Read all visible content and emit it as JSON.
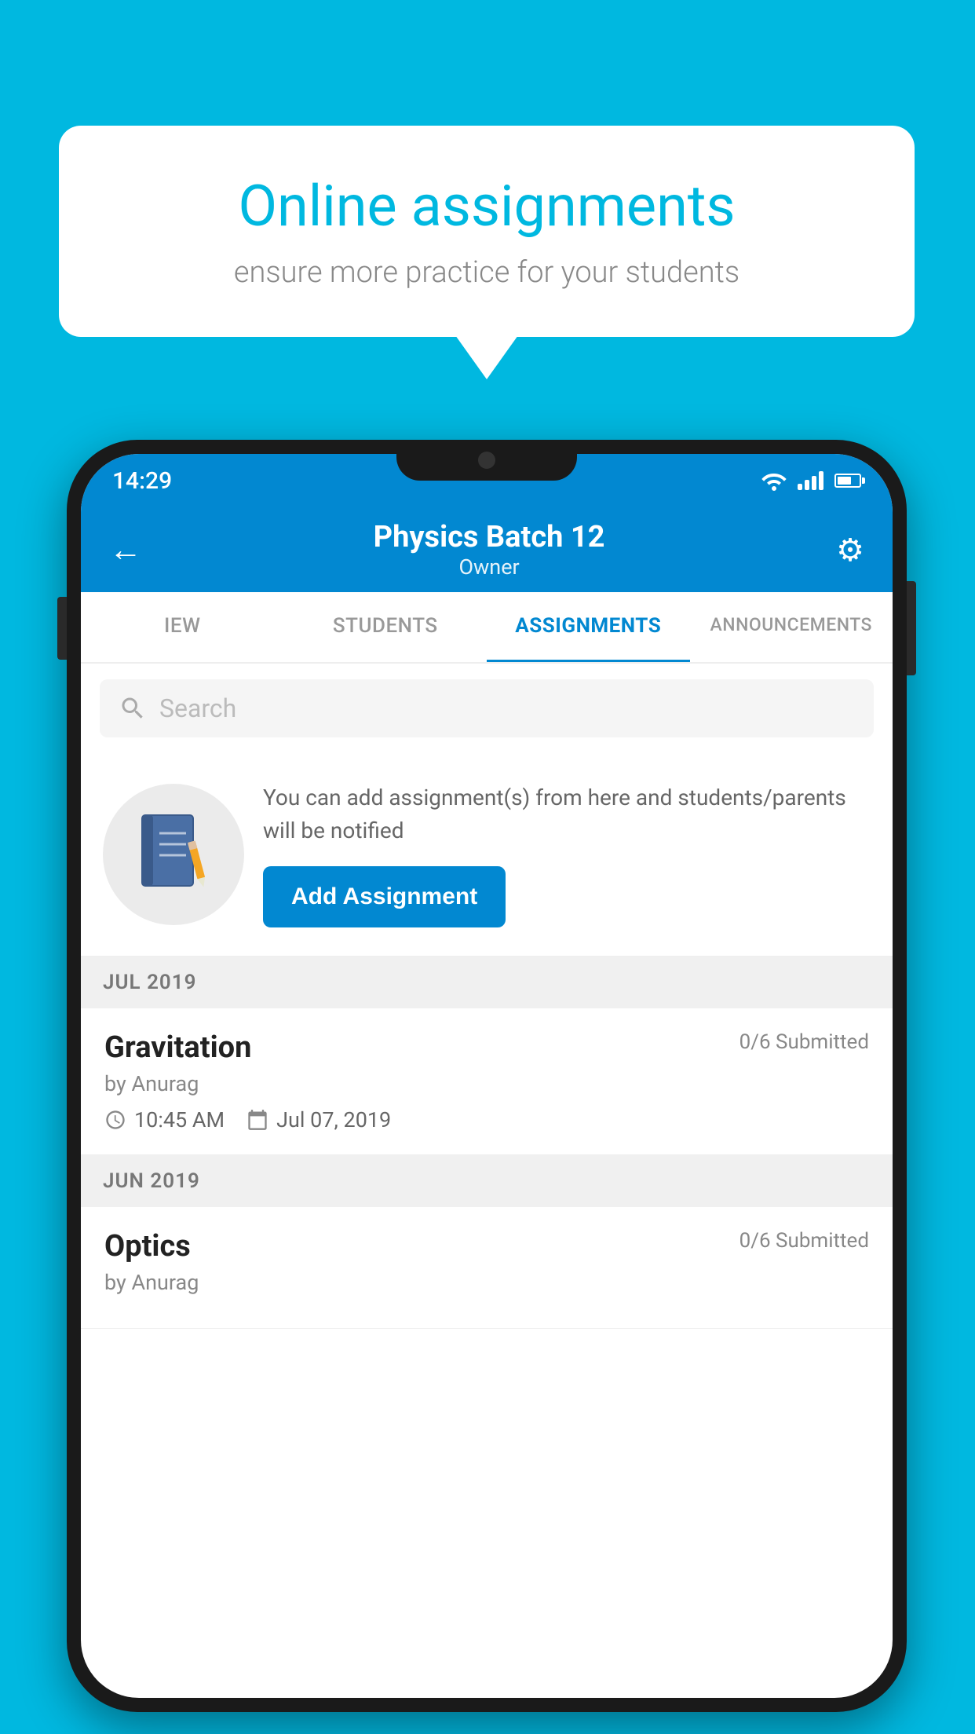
{
  "background_color": "#00b8e0",
  "speech_bubble": {
    "title": "Online assignments",
    "subtitle": "ensure more practice for your students"
  },
  "status_bar": {
    "time": "14:29",
    "wifi": "▾",
    "battery_level": 65
  },
  "app_header": {
    "back_label": "←",
    "title": "Physics Batch 12",
    "subtitle": "Owner",
    "settings_label": "⚙"
  },
  "tabs": [
    {
      "id": "view",
      "label": "IEW"
    },
    {
      "id": "students",
      "label": "STUDENTS"
    },
    {
      "id": "assignments",
      "label": "ASSIGNMENTS",
      "active": true
    },
    {
      "id": "announcements",
      "label": "ANNOUNCEMENTS"
    }
  ],
  "search": {
    "placeholder": "Search"
  },
  "promo": {
    "description": "You can add assignment(s) from here and students/parents will be notified",
    "add_button_label": "Add Assignment"
  },
  "sections": [
    {
      "header": "JUL 2019",
      "assignments": [
        {
          "name": "Gravitation",
          "submitted": "0/6 Submitted",
          "author": "by Anurag",
          "time": "10:45 AM",
          "date": "Jul 07, 2019"
        }
      ]
    },
    {
      "header": "JUN 2019",
      "assignments": [
        {
          "name": "Optics",
          "submitted": "0/6 Submitted",
          "author": "by Anurag",
          "time": "",
          "date": ""
        }
      ]
    }
  ]
}
